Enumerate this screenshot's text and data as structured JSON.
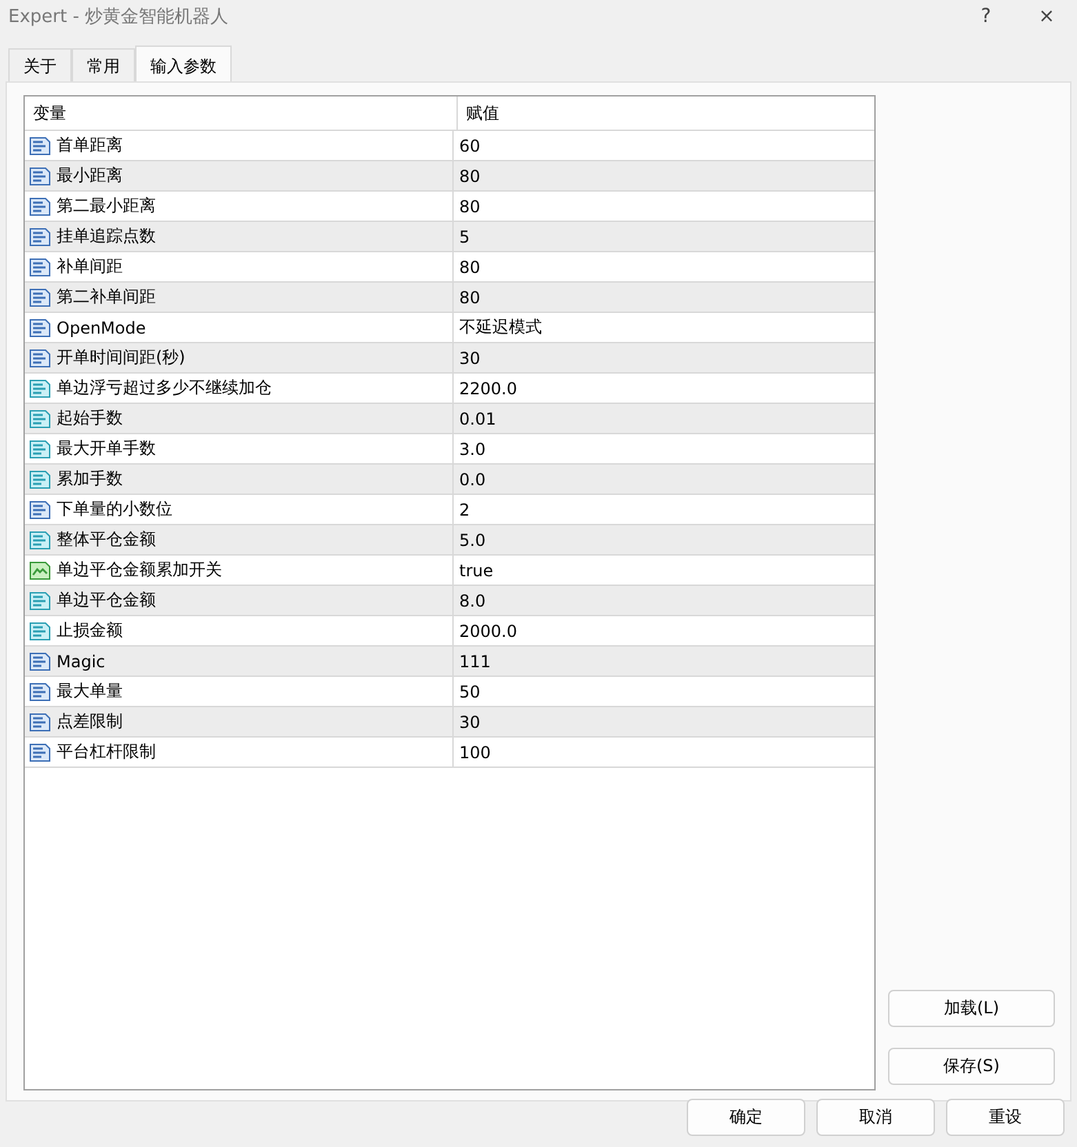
{
  "window": {
    "title": "Expert - 炒黄金智能机器人",
    "help": "?",
    "close": "×"
  },
  "tabs": [
    {
      "label": "关于",
      "selected": false
    },
    {
      "label": "常用",
      "selected": false
    },
    {
      "label": "输入参数",
      "selected": true
    }
  ],
  "table": {
    "columns": [
      "变量",
      "赋值"
    ],
    "rows": [
      {
        "kind": "int",
        "name": "首单距离",
        "value": "60"
      },
      {
        "kind": "int",
        "name": "最小距离",
        "value": "80"
      },
      {
        "kind": "int",
        "name": "第二最小距离",
        "value": "80"
      },
      {
        "kind": "int",
        "name": "挂单追踪点数",
        "value": "5"
      },
      {
        "kind": "int",
        "name": "补单间距",
        "value": "80"
      },
      {
        "kind": "int",
        "name": "第二补单间距",
        "value": "80"
      },
      {
        "kind": "int",
        "name": "OpenMode",
        "value": "不延迟模式"
      },
      {
        "kind": "int",
        "name": "开单时间间距(秒)",
        "value": "30"
      },
      {
        "kind": "double",
        "name": "单边浮亏超过多少不继续加仓",
        "value": "2200.0"
      },
      {
        "kind": "double",
        "name": "起始手数",
        "value": "0.01"
      },
      {
        "kind": "double",
        "name": "最大开单手数",
        "value": "3.0"
      },
      {
        "kind": "double",
        "name": "累加手数",
        "value": "0.0"
      },
      {
        "kind": "int",
        "name": "下单量的小数位",
        "value": "2"
      },
      {
        "kind": "double",
        "name": "整体平仓金额",
        "value": "5.0"
      },
      {
        "kind": "bool",
        "name": "单边平仓金额累加开关",
        "value": "true"
      },
      {
        "kind": "double",
        "name": "单边平仓金额",
        "value": "8.0"
      },
      {
        "kind": "double",
        "name": "止损金额",
        "value": "2000.0"
      },
      {
        "kind": "int",
        "name": "Magic",
        "value": "111"
      },
      {
        "kind": "int",
        "name": "最大单量",
        "value": "50"
      },
      {
        "kind": "int",
        "name": "点差限制",
        "value": "30"
      },
      {
        "kind": "int",
        "name": "平台杠杆限制",
        "value": "100"
      }
    ]
  },
  "side_buttons": [
    "加载(L)",
    "保存(S)"
  ],
  "footer_buttons": [
    "确定",
    "取消",
    "重设"
  ]
}
